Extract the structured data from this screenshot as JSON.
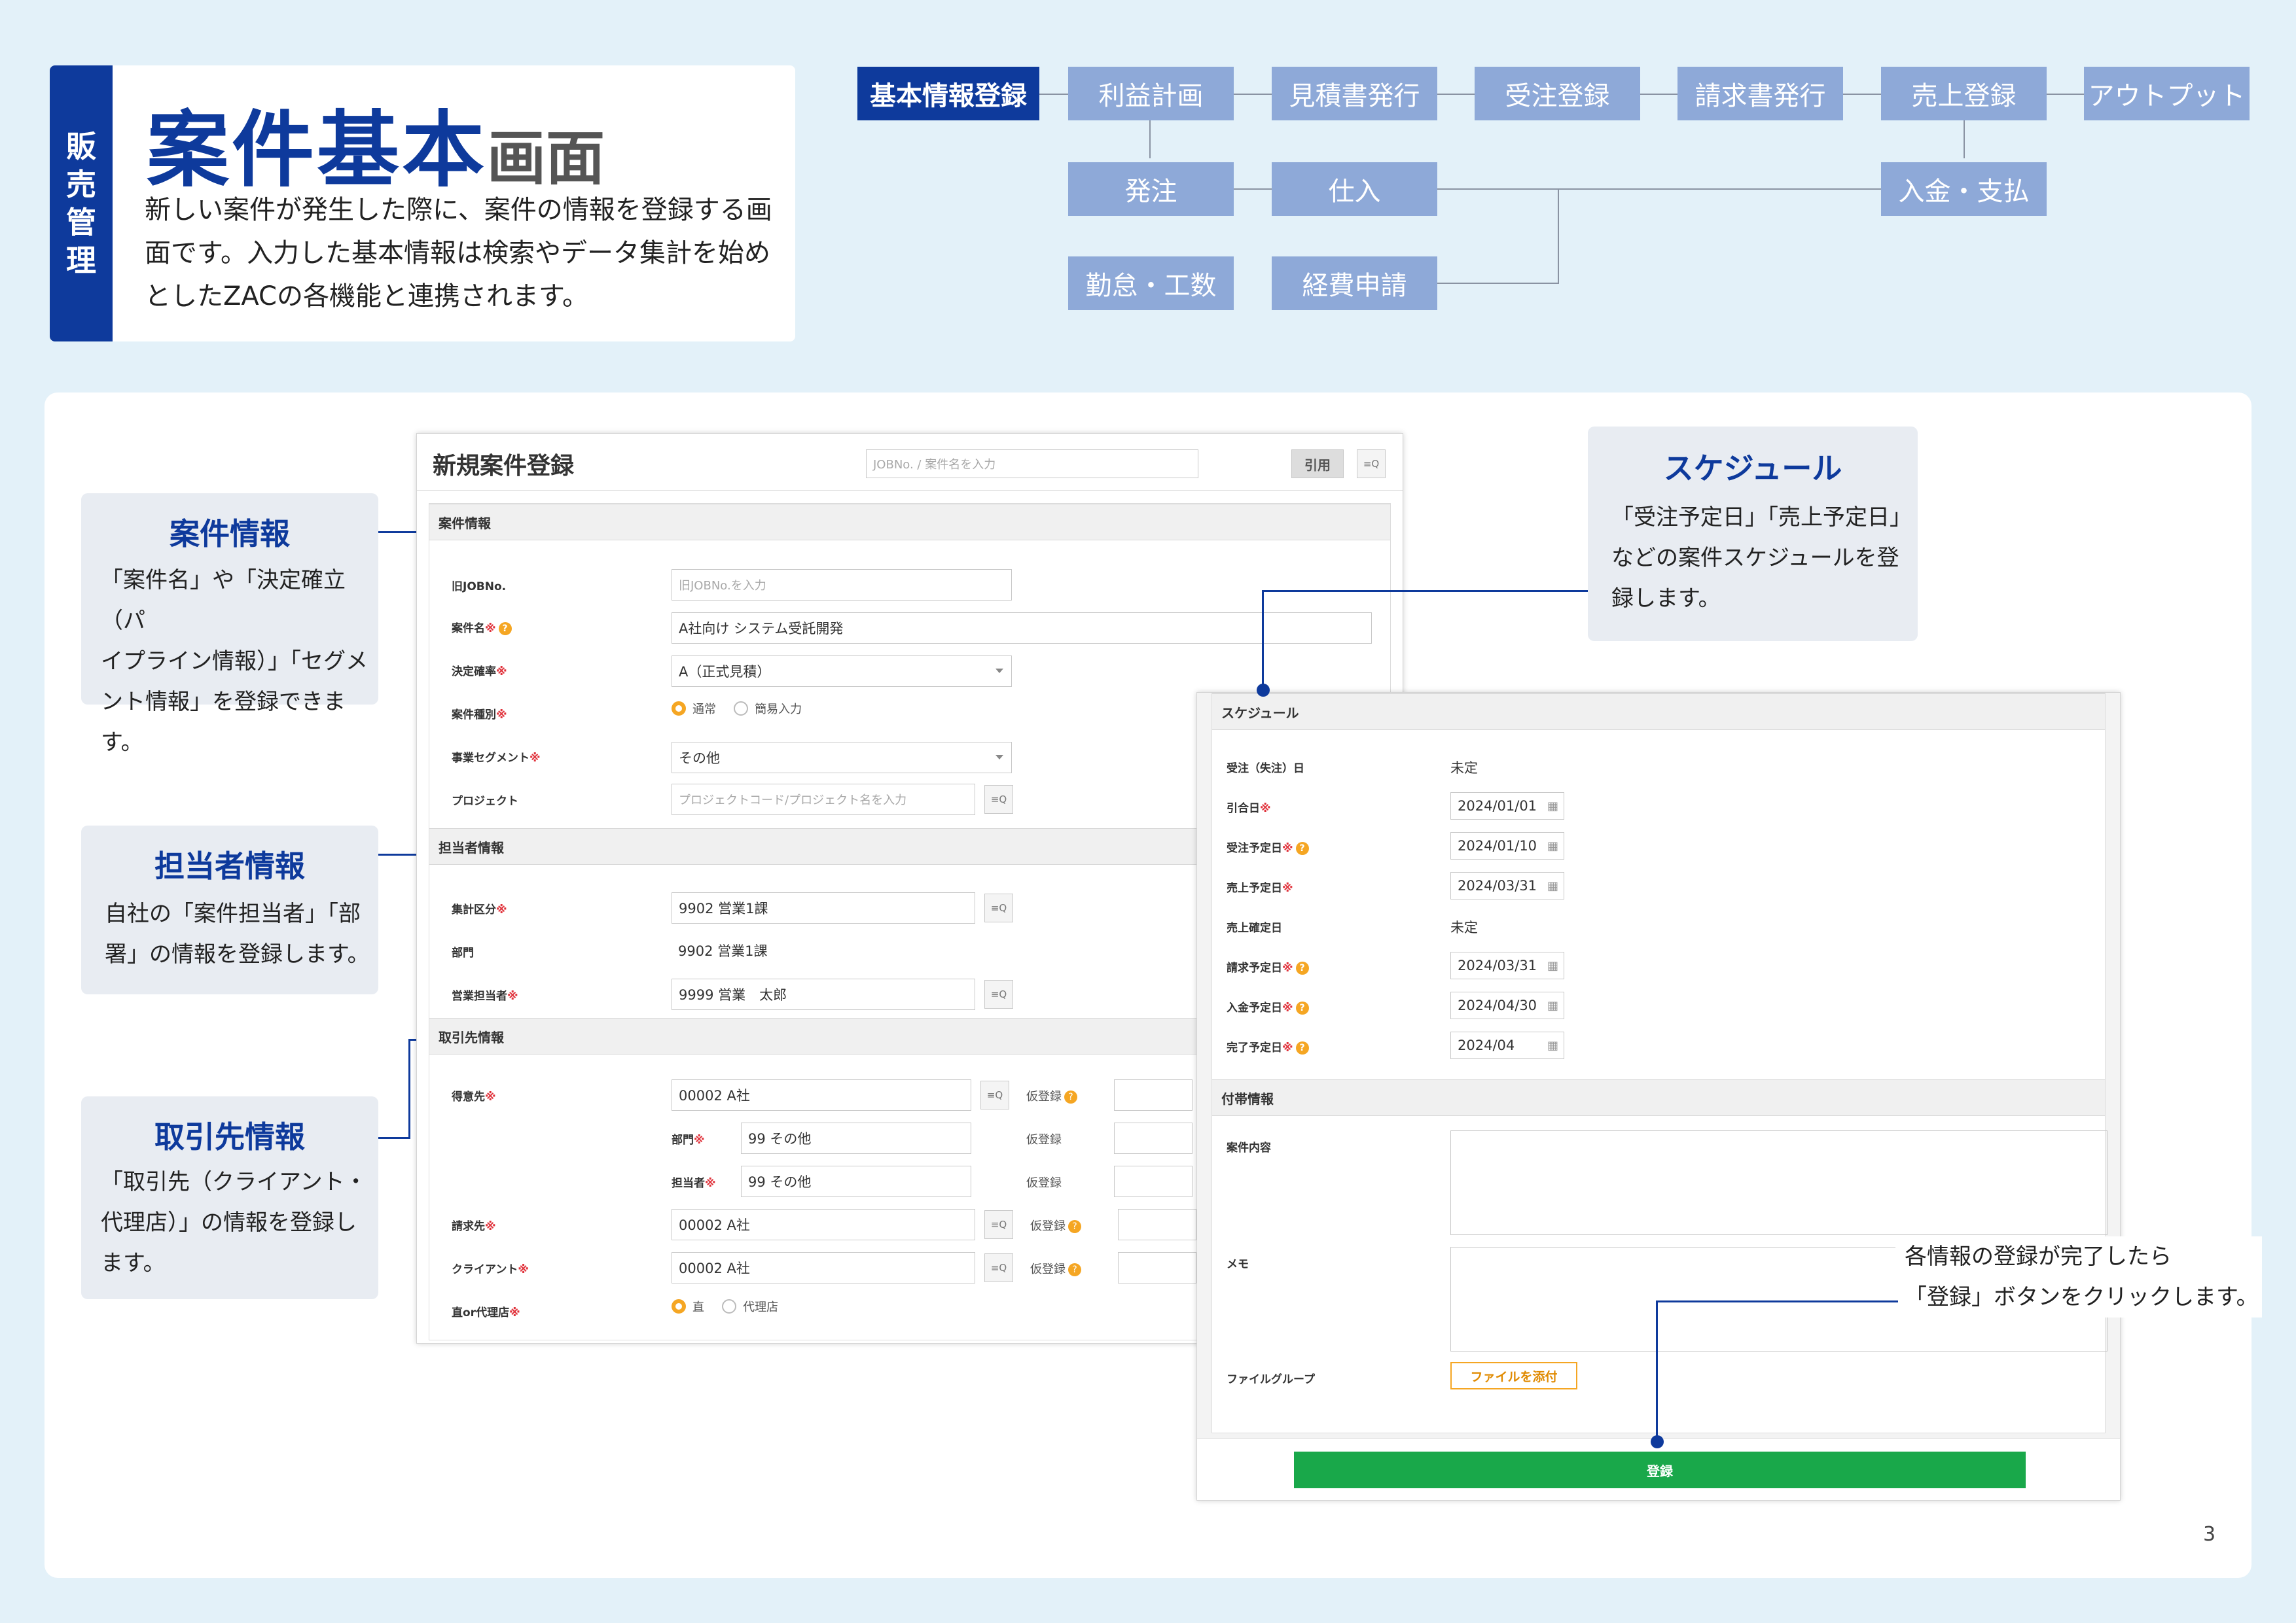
{
  "header": {
    "tag": [
      "販",
      "売",
      "管",
      "理"
    ],
    "title_main": "案件基本",
    "title_sub": "画面",
    "description": [
      "新しい案件が発生した際に、案件の情報を登録する画",
      "面です。入力した基本情報は検索やデータ集計を始め",
      "としたZACの各機能と連携されます。"
    ]
  },
  "flow": {
    "kihon": "基本情報登録",
    "rieki": "利益計画",
    "mitsumori": "見積書発行",
    "juchu": "受注登録",
    "seikyu": "請求書発行",
    "uriage": "売上登録",
    "output": "アウトプット",
    "hacchu": "発注",
    "shiire": "仕入",
    "nyukin": "入金・支払",
    "kintai": "勤怠・工数",
    "keihi": "経費申請"
  },
  "callouts": {
    "anken": {
      "title": "案件情報",
      "body": [
        "「案件名」や「決定確立（パ",
        "イプライン情報）」「セグメ",
        "ント情報」を登録できます。"
      ]
    },
    "tanto": {
      "title": "担当者情報",
      "body": [
        "自社の「案件担当者」「部",
        "署」の情報を登録します。"
      ]
    },
    "torihiki": {
      "title": "取引先情報",
      "body": [
        "「取引先（クライアント・",
        "代理店）」の情報を登録し",
        "ます。"
      ]
    },
    "schedule": {
      "title": "スケジュール",
      "body": [
        "「受注予定日」「売上予定日」",
        "などの案件スケジュールを登",
        "録します。"
      ]
    },
    "register": {
      "body": [
        "各情報の登録が完了したら",
        "「登録」ボタンをクリックします。"
      ]
    }
  },
  "form1": {
    "title": "新規案件登録",
    "search_placeholder": "JOBNo. / 案件名を入力",
    "quote_button": "引用",
    "search_icon": "≡Q",
    "sec_anken": "案件情報",
    "old_job_label": "旧JOBNo.",
    "old_job_placeholder": "旧JOBNo.を入力",
    "name_label": "案件名",
    "name_value": "A社向け システム受託開発",
    "prob_label": "決定確率",
    "prob_value": "A（正式見積）",
    "kind_label": "案件種別",
    "kind_opt1": "通常",
    "kind_opt2": "簡易入力",
    "seg_label": "事業セグメント",
    "seg_value": "その他",
    "proj_label": "プロジェクト",
    "proj_placeholder": "プロジェクトコード/プロジェクト名を入力",
    "sec_tanto": "担当者情報",
    "shukei_label": "集計区分",
    "shukei_value": "9902 営業1課",
    "bumon_label": "部門",
    "bumon_value": "9902 営業1課",
    "eigyo_label": "営業担当者",
    "eigyo_value": "9999 営業　太郎",
    "sec_torihiki": "取引先情報",
    "tokui_label": "得意先",
    "tokui_value": "00002 A社",
    "sub_bumon_label": "部門",
    "sub_bumon_value": "99 その他",
    "sub_tanto_label": "担当者",
    "sub_tanto_value": "99 その他",
    "seikyu_label": "請求先",
    "seikyu_value": "00002 A社",
    "client_label": "クライアント",
    "client_value": "00002 A社",
    "dairi_label": "直or代理店",
    "dairi_opt1": "直",
    "dairi_opt2": "代理店",
    "kari": "仮登録",
    "req": "※",
    "q": "?"
  },
  "form2": {
    "sec_schedule": "スケジュール",
    "rows": [
      {
        "label": "受注（失注）日",
        "value": "未定",
        "req": false,
        "q": false,
        "input": false
      },
      {
        "label": "引合日",
        "value": "2024/01/01",
        "req": true,
        "q": false,
        "input": true
      },
      {
        "label": "受注予定日",
        "value": "2024/01/10",
        "req": true,
        "q": true,
        "input": true
      },
      {
        "label": "売上予定日",
        "value": "2024/03/31",
        "req": true,
        "q": false,
        "input": true
      },
      {
        "label": "売上確定日",
        "value": "未定",
        "req": false,
        "q": false,
        "input": false
      },
      {
        "label": "請求予定日",
        "value": "2024/03/31",
        "req": true,
        "q": true,
        "input": true
      },
      {
        "label": "入金予定日",
        "value": "2024/04/30",
        "req": true,
        "q": true,
        "input": true
      },
      {
        "label": "完了予定日",
        "value": "2024/04",
        "req": true,
        "q": true,
        "input": true
      }
    ],
    "sec_futai": "付帯情報",
    "content_label": "案件内容",
    "memo_label": "メモ",
    "file_label": "ファイルグループ",
    "file_button": "ファイルを添付",
    "register_button": "登録",
    "calendar_icon": "▦"
  },
  "page_number": "3",
  "colors": {
    "navy": "#0e3a9c",
    "flow_box": "#8ea9d8",
    "bg": "#e3f1f9",
    "green": "#19a84a",
    "orange": "#f5a623"
  }
}
